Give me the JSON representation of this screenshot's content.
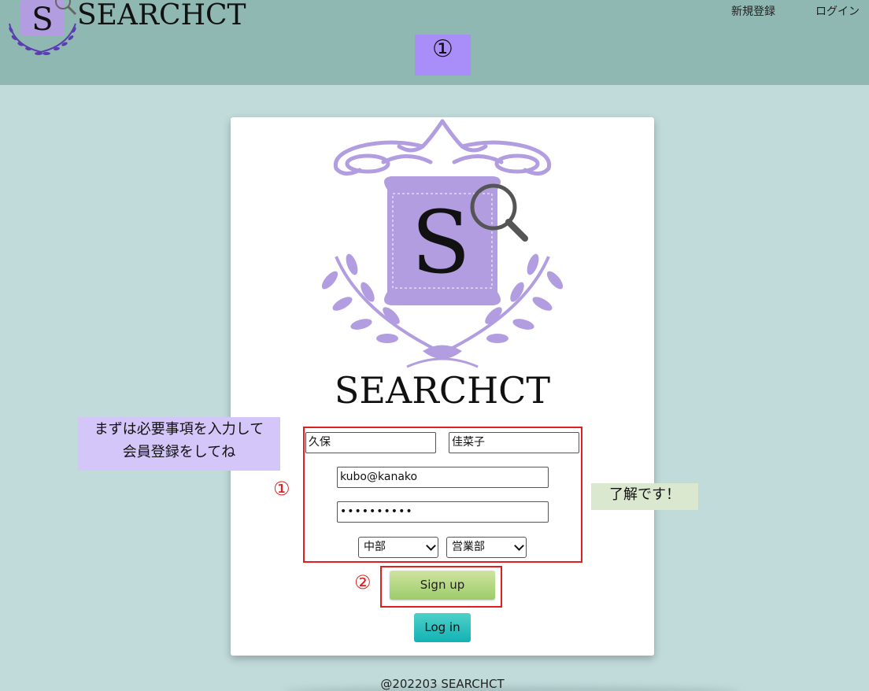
{
  "header": {
    "brand": "SEARCHCT",
    "nav_signup": "新規登録",
    "nav_login": "ログイン",
    "marker": "①"
  },
  "card": {
    "brand": "SEARCHCT",
    "logo_letter": "S"
  },
  "form": {
    "last_name": "久保",
    "first_name": "佳菜子",
    "email": "kubo@kanako",
    "password_masked": "••••••••••",
    "region": "中部",
    "department": "営業部"
  },
  "buttons": {
    "signup": "Sign up",
    "login": "Log in"
  },
  "annotations": {
    "marker_form": "①",
    "marker_signup": "②",
    "note_left": [
      "まずは必要事項を入力して",
      "会員登録をしてね"
    ],
    "note_right": "了解です！"
  },
  "footer": {
    "copyright": "@202203 SEARCHCT"
  },
  "colors": {
    "header_bg": "#8fb8b2",
    "page_bg": "#c1dada",
    "logo_purple": "#b19de0",
    "highlight_red": "#e02020"
  },
  "icons": {
    "logo": "magnifier-s-crest-icon"
  }
}
